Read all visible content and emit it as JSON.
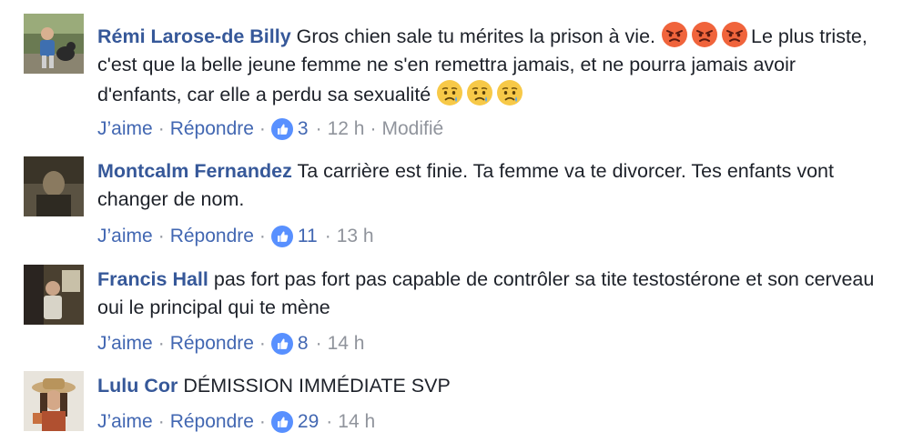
{
  "comments": [
    {
      "author": "Rémi Larose-de Billy",
      "text_part1": "Gros chien sale tu mérites la prison à vie.",
      "text_part2": "Le plus triste, c'est que la belle jeune femme ne s'en remettra jamais, et ne pourra jamais avoir d'enfants, car elle a perdu sa sexualité",
      "like_label": "J’aime",
      "reply_label": "Répondre",
      "like_count": "3",
      "time": "12 h",
      "edited": "Modifié",
      "emoji_group1": "angry-face-icon",
      "emoji_group2": "sad-face-icon"
    },
    {
      "author": "Montcalm Fernandez",
      "text": "Ta carrière est finie. Ta femme va te divorcer. Tes enfants vont changer de nom.",
      "like_label": "J’aime",
      "reply_label": "Répondre",
      "like_count": "11",
      "time": "13 h"
    },
    {
      "author": "Francis Hall",
      "text": "pas fort pas fort pas capable de contrôler sa tite testostérone et son cerveau oui le principal qui te mène",
      "like_label": "J’aime",
      "reply_label": "Répondre",
      "like_count": "8",
      "time": "14 h"
    },
    {
      "author": "Lulu Cor",
      "text": "DÉMISSION IMMÉDIATE SVP",
      "like_label": "J’aime",
      "reply_label": "Répondre",
      "like_count": "29",
      "time": "14 h"
    }
  ],
  "colors": {
    "link": "#4267b2",
    "author": "#365899",
    "meta": "#90949c",
    "like_badge": "#5890ff"
  }
}
